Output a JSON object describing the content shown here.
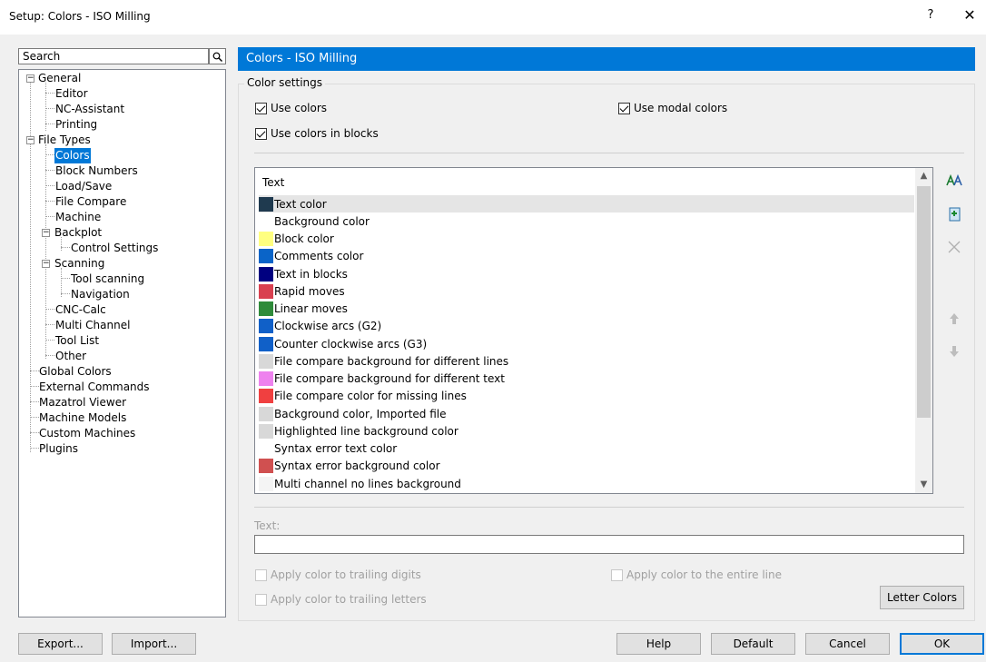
{
  "window": {
    "title": "Setup: Colors - ISO Milling",
    "help_label": "?",
    "close_label": "✕"
  },
  "search": {
    "placeholder": "Search"
  },
  "tree": [
    {
      "label": "General"
    },
    {
      "label": "Editor"
    },
    {
      "label": "NC-Assistant"
    },
    {
      "label": "Printing"
    },
    {
      "label": "File Types"
    },
    {
      "label": "Colors"
    },
    {
      "label": "Block Numbers"
    },
    {
      "label": "Load/Save"
    },
    {
      "label": "File Compare"
    },
    {
      "label": "Machine"
    },
    {
      "label": "Backplot"
    },
    {
      "label": "Control Settings"
    },
    {
      "label": "Scanning"
    },
    {
      "label": "Tool scanning"
    },
    {
      "label": "Navigation"
    },
    {
      "label": "CNC-Calc"
    },
    {
      "label": "Multi Channel"
    },
    {
      "label": "Tool List"
    },
    {
      "label": "Other"
    },
    {
      "label": "Global Colors"
    },
    {
      "label": "External Commands"
    },
    {
      "label": "Mazatrol Viewer"
    },
    {
      "label": "Machine Models"
    },
    {
      "label": "Custom Machines"
    },
    {
      "label": "Plugins"
    }
  ],
  "panel": {
    "title": "Colors - ISO Milling",
    "group_label": "Color settings",
    "use_colors": "Use colors",
    "use_modal_colors": "Use modal colors",
    "use_colors_in_blocks": "Use colors in blocks",
    "list_header": "Text",
    "items": [
      {
        "label": "Text color",
        "color": "#1f3a4f"
      },
      {
        "label": "Background color",
        "color": "#ffffff"
      },
      {
        "label": "Block color",
        "color": "#ffff80"
      },
      {
        "label": "Comments color",
        "color": "#0a64c8"
      },
      {
        "label": "Text in blocks",
        "color": "#000080"
      },
      {
        "label": "Rapid moves",
        "color": "#d94050"
      },
      {
        "label": "Linear moves",
        "color": "#2e8b3a"
      },
      {
        "label": "Clockwise arcs (G2)",
        "color": "#1060c8"
      },
      {
        "label": "Counter clockwise arcs (G3)",
        "color": "#1060c8"
      },
      {
        "label": "File compare background for different lines",
        "color": "#d8d8d8"
      },
      {
        "label": "File compare background for different text",
        "color": "#ee82ee"
      },
      {
        "label": "File compare color for missing lines",
        "color": "#f04040"
      },
      {
        "label": "Background color, Imported file",
        "color": "#d8d8d8"
      },
      {
        "label": "Highlighted line background color",
        "color": "#d8d8d8"
      },
      {
        "label": "Syntax error text color",
        "color": "#ffffff"
      },
      {
        "label": "Syntax error background color",
        "color": "#d05050"
      },
      {
        "label": "Multi channel no lines background",
        "color": "#f4f4f4"
      }
    ],
    "text_label": "Text:",
    "text_value": "",
    "apply_trailing_digits": "Apply color to trailing digits",
    "apply_entire_line": "Apply color to the entire line",
    "apply_trailing_letters": "Apply color to trailing letters",
    "letter_colors": "Letter Colors"
  },
  "footer": {
    "export": "Export...",
    "import": "Import...",
    "help": "Help",
    "default": "Default",
    "cancel": "Cancel",
    "ok": "OK"
  }
}
